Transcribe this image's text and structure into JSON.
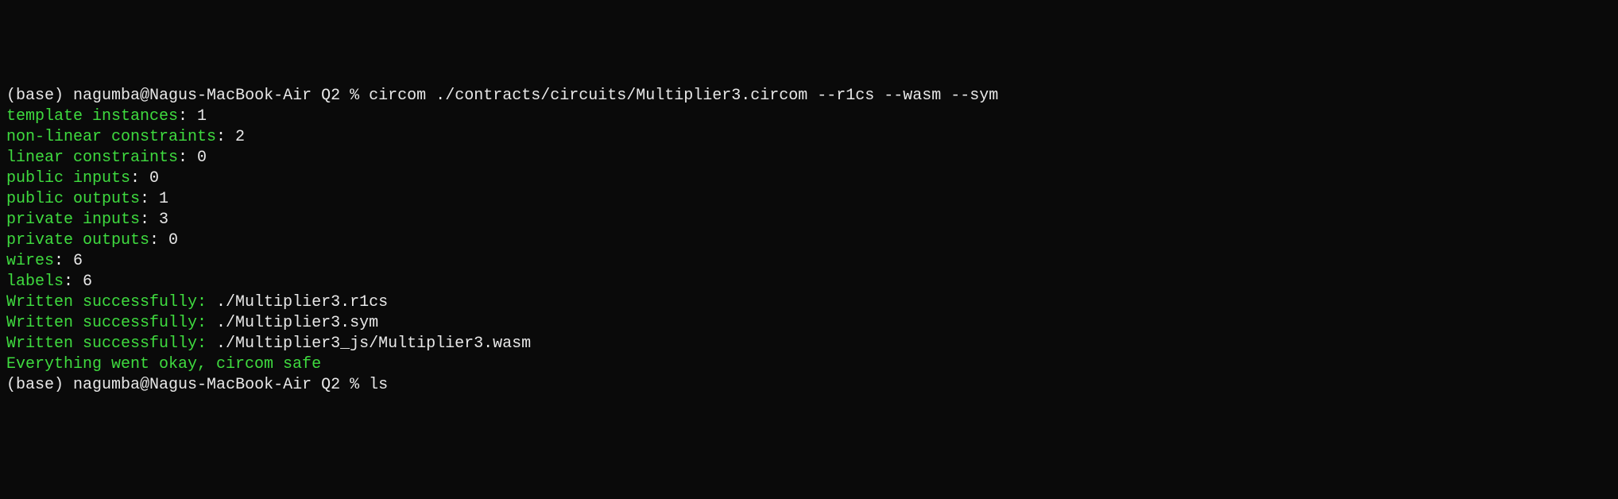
{
  "prompt1": {
    "env": "(base)",
    "userhost": "nagumba@Nagus-MacBook-Air",
    "dir": "Q2",
    "sep": "%",
    "cmd": "circom ./contracts/circuits/Multiplier3.circom --r1cs --wasm --sym"
  },
  "stats": {
    "template_instances_label": "template instances",
    "template_instances_value": ": 1",
    "non_linear_label": "non-linear constraints",
    "non_linear_value": ": 2",
    "linear_label": "linear constraints",
    "linear_value": ": 0",
    "public_inputs_label": "public inputs",
    "public_inputs_value": ": 0",
    "public_outputs_label": "public outputs",
    "public_outputs_value": ": 1",
    "private_inputs_label": "private inputs",
    "private_inputs_value": ": 3",
    "private_outputs_label": "private outputs",
    "private_outputs_value": ": 0",
    "wires_label": "wires",
    "wires_value": ": 6",
    "labels_label": "labels",
    "labels_value": ": 6"
  },
  "written": {
    "label": "Written successfully: ",
    "file1": "./Multiplier3.r1cs",
    "file2": "./Multiplier3.sym",
    "file3": "./Multiplier3_js/Multiplier3.wasm"
  },
  "success": "Everything went okay, circom safe",
  "prompt2": {
    "env": "(base)",
    "userhost": "nagumba@Nagus-MacBook-Air",
    "dir": "Q2",
    "sep": "%",
    "cmd": "ls"
  }
}
